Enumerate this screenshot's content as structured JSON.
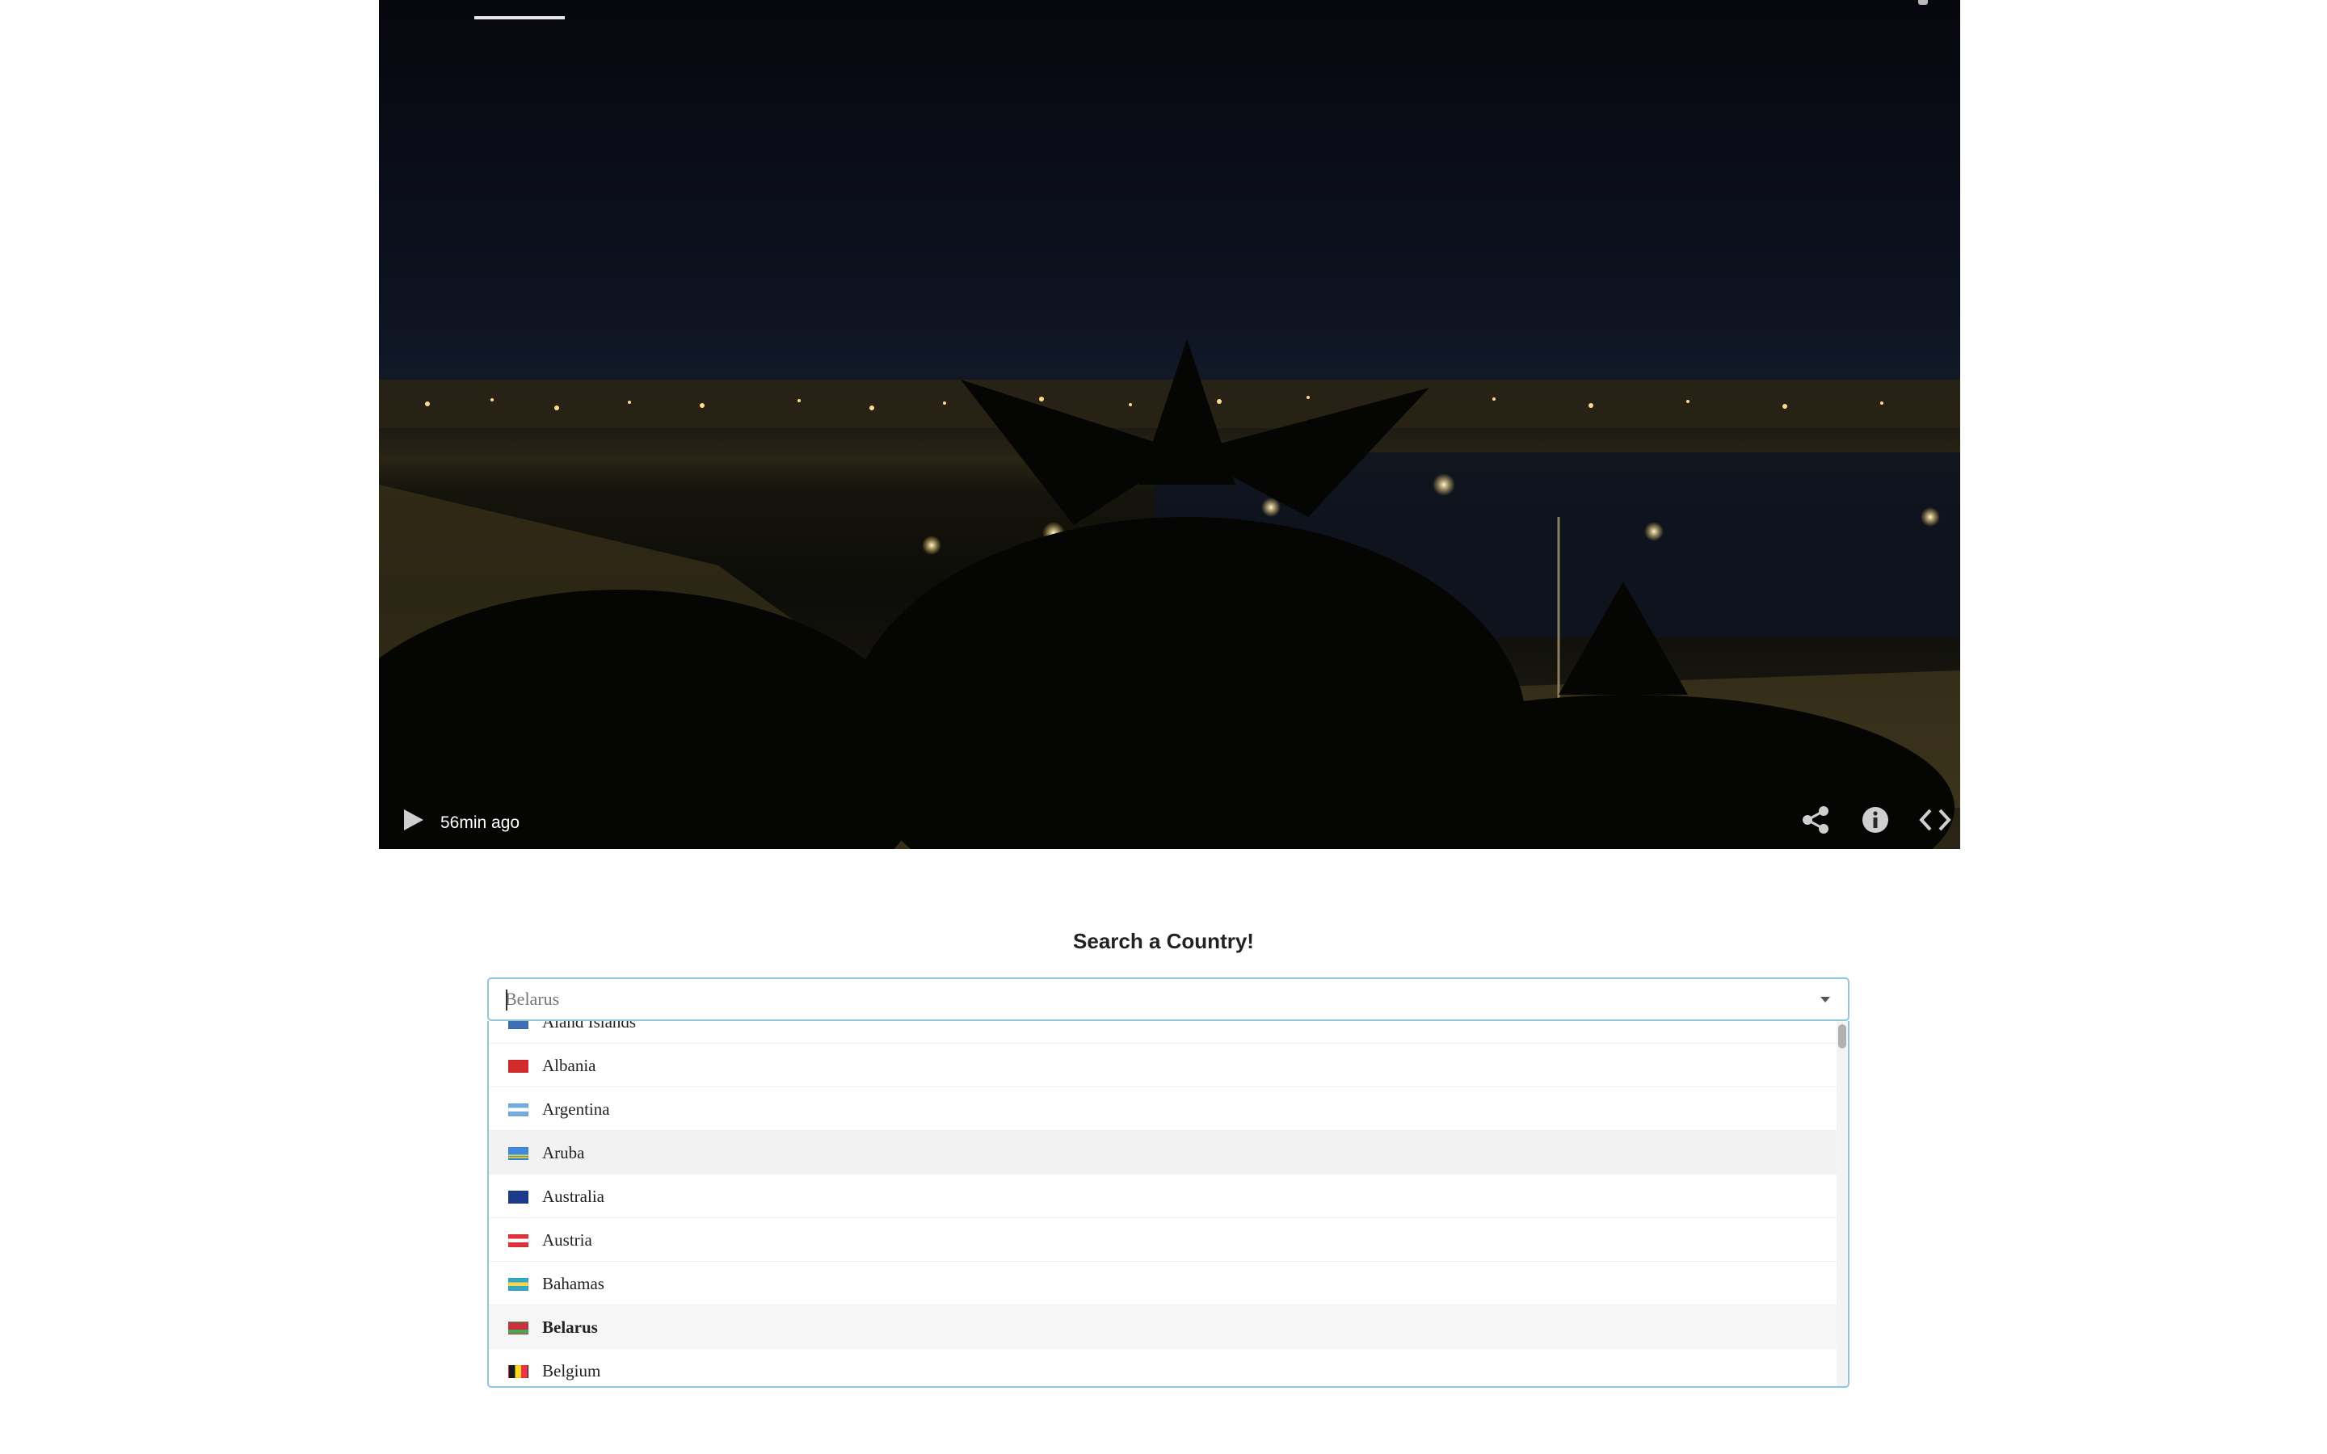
{
  "player": {
    "timestamp": "56min ago",
    "icons": {
      "play": "play-icon",
      "share": "share-icon",
      "info": "info-icon",
      "embed": "embed-code-icon"
    }
  },
  "search": {
    "title": "Search a Country!",
    "input_value": "Belarus",
    "options": [
      {
        "label": "Aland Islands",
        "flag": "aland"
      },
      {
        "label": "Albania",
        "flag": "albania"
      },
      {
        "label": "Argentina",
        "flag": "argentina"
      },
      {
        "label": "Aruba",
        "flag": "aruba",
        "state": "hover"
      },
      {
        "label": "Australia",
        "flag": "australia"
      },
      {
        "label": "Austria",
        "flag": "austria"
      },
      {
        "label": "Bahamas",
        "flag": "bahamas"
      },
      {
        "label": "Belarus",
        "flag": "belarus",
        "state": "selected"
      },
      {
        "label": "Belgium",
        "flag": "belgium"
      }
    ]
  }
}
